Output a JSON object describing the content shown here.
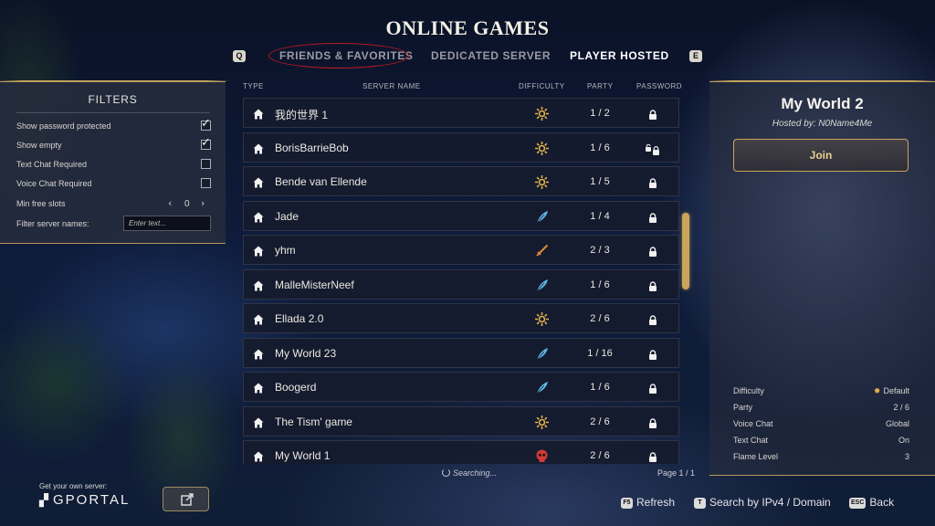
{
  "header": {
    "title": "ONLINE GAMES",
    "tab_key_left": "Q",
    "tab_key_right": "E",
    "tabs": [
      {
        "label": "FRIENDS & FAVORITES"
      },
      {
        "label": "DEDICATED SERVER"
      },
      {
        "label": "PLAYER HOSTED"
      }
    ],
    "active_tab": "PLAYER HOSTED",
    "annotation_color": "#c21a22"
  },
  "filters": {
    "title": "FILTERS",
    "rows": [
      {
        "label": "Show password protected",
        "checked": true
      },
      {
        "label": "Show empty",
        "checked": true
      },
      {
        "label": "Text Chat Required",
        "checked": false
      },
      {
        "label": "Voice Chat Required",
        "checked": false
      }
    ],
    "min_free_slots": {
      "label": "Min free slots",
      "value": "0"
    },
    "filter_names": {
      "label": "Filter server names:",
      "placeholder": "Enter text..."
    }
  },
  "columns": {
    "type": "TYPE",
    "server_name": "SERVER NAME",
    "difficulty": "DIFFICULTY",
    "party": "PARTY",
    "password": "PASSWORD"
  },
  "servers": [
    {
      "name": "我的世界 1",
      "difficulty": "default-sun-icon",
      "party": "1 / 2",
      "password": "locked"
    },
    {
      "name": "BorisBarrieBob",
      "difficulty": "default-sun-icon",
      "party": "1 / 6",
      "password": "locked-unlocked"
    },
    {
      "name": "Bende van Ellende",
      "difficulty": "default-sun-icon",
      "party": "1 / 5",
      "password": "locked"
    },
    {
      "name": "Jade",
      "difficulty": "easy-feather-icon",
      "party": "1 / 4",
      "password": "locked"
    },
    {
      "name": "yhm",
      "difficulty": "hard-sword-icon",
      "party": "2 / 3",
      "password": "locked"
    },
    {
      "name": "MalleMisterNeef",
      "difficulty": "easy-feather-icon",
      "party": "1 / 6",
      "password": "locked"
    },
    {
      "name": "Ellada 2.0",
      "difficulty": "default-sun-icon",
      "party": "2 / 6",
      "password": "locked"
    },
    {
      "name": "My World 23",
      "difficulty": "easy-feather-icon",
      "party": "1 / 16",
      "password": "locked"
    },
    {
      "name": "Boogerd",
      "difficulty": "easy-feather-icon",
      "party": "1 / 6",
      "password": "locked"
    },
    {
      "name": "The Tism' game",
      "difficulty": "default-sun-icon",
      "party": "2 / 6",
      "password": "locked"
    },
    {
      "name": "My World 1",
      "difficulty": "deadly-skull-icon",
      "party": "2 / 6",
      "password": "locked"
    }
  ],
  "status": {
    "searching": "Searching...",
    "page": "Page 1 / 1"
  },
  "detail": {
    "title": "My World 2",
    "hosted_by": "Hosted by: N0Name4Me",
    "join_label": "Join",
    "stats": [
      {
        "key": "Difficulty",
        "value": "Default"
      },
      {
        "key": "Party",
        "value": "2 / 6"
      },
      {
        "key": "Voice Chat",
        "value": "Global"
      },
      {
        "key": "Text Chat",
        "value": "On"
      },
      {
        "key": "Flame Level",
        "value": "3"
      }
    ]
  },
  "footer": {
    "gportal_tagline": "Get your own server:",
    "gportal_logo": "GPORTAL",
    "refresh_key": "F5",
    "refresh_label": "Refresh",
    "search_key": "T",
    "search_label": "Search by IPv4 / Domain",
    "back_key": "ESC",
    "back_label": "Back"
  },
  "colors": {
    "gold": "#cdaa5f",
    "default_difficulty": "#e3b24a",
    "easy_difficulty": "#5fb6e6",
    "hard_difficulty": "#e08a3a",
    "deadly_difficulty": "#d23a3a"
  }
}
